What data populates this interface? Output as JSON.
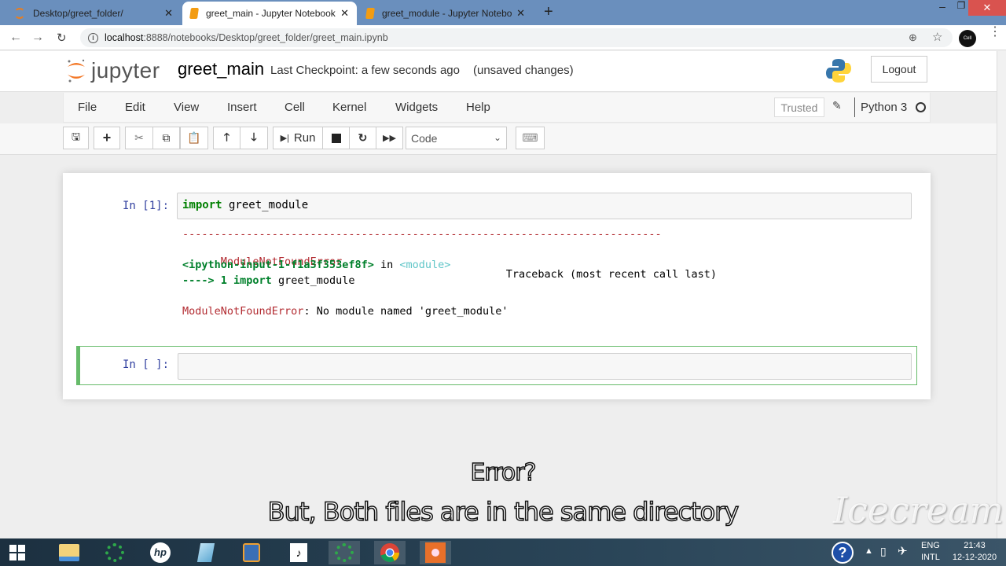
{
  "browser": {
    "tabs": [
      {
        "title": "Desktop/greet_folder/",
        "active": false
      },
      {
        "title": "greet_main - Jupyter Notebook",
        "active": true
      },
      {
        "title": "greet_module - Jupyter Notebo",
        "active": false
      }
    ],
    "new_tab": "+",
    "window_controls": {
      "minimize": "–",
      "restore": "❐",
      "close": "✕"
    },
    "url_host": "localhost",
    "url_path": ":8888/notebooks/Desktop/greet_folder/greet_main.ipynb",
    "avatar_label": "Cell"
  },
  "jupyter": {
    "logo_text": "jupyter",
    "notebook_name": "greet_main",
    "checkpoint": "Last Checkpoint: a few seconds ago",
    "unsaved": "(unsaved changes)",
    "logout": "Logout",
    "menu": [
      "File",
      "Edit",
      "View",
      "Insert",
      "Cell",
      "Kernel",
      "Widgets",
      "Help"
    ],
    "trusted": "Trusted",
    "kernel_name": "Python 3",
    "toolbar": {
      "run_label": "Run",
      "cell_type": "Code"
    }
  },
  "cells": [
    {
      "prompt": "In [1]:",
      "code_keyword": "import",
      "code_rest": " greet_module",
      "output": {
        "dashes": "---------------------------------------------------------------------------",
        "error_name": "ModuleNotFoundError",
        "traceback_label": "Traceback (most recent call last)",
        "input_ref": "<ipython-input-1-f1a3f353ef8f>",
        "in_word": " in ",
        "module_ref": "<module>",
        "arrow_line_prefix": "----> 1 ",
        "arrow_keyword": "import",
        "arrow_rest": " greet_module",
        "final_error_name": "ModuleNotFoundError",
        "final_message": ": No module named 'greet_module'"
      }
    },
    {
      "prompt": "In [ ]:",
      "code": ""
    }
  ],
  "captions": {
    "line1": "Error?",
    "line2": "But, Both files are in the same directory"
  },
  "watermark": "Icecream",
  "taskbar": {
    "language_top": "ENG",
    "language_bottom": "INTL",
    "time": "21:43",
    "date": "12-12-2020"
  }
}
